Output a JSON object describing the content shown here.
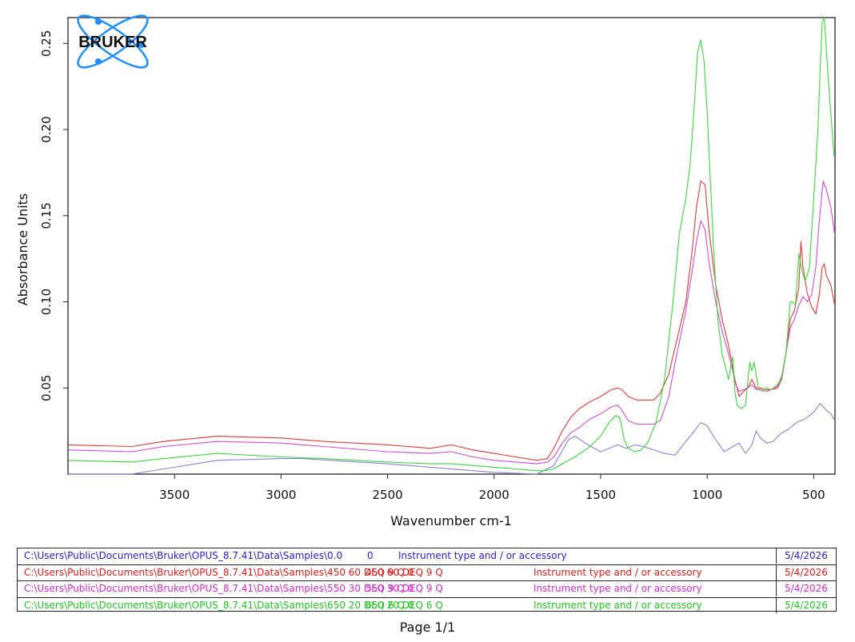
{
  "logo_text": "BRUKER",
  "chart_data": {
    "type": "line",
    "xlabel": "Wavenumber cm-1",
    "ylabel": "Absorbance Units",
    "xlim": [
      4000,
      400
    ],
    "ylim": [
      0,
      0.265
    ],
    "x_reversed": true,
    "grid": false,
    "x_ticks": [
      3500,
      3000,
      2500,
      2000,
      1500,
      1000,
      500
    ],
    "y_ticks": [
      0.05,
      0.1,
      0.15,
      0.2,
      0.25
    ],
    "y_tick_labels": [
      "0.05",
      "0.10",
      "0.15",
      "0.20",
      "0.25"
    ],
    "series": [
      {
        "name": "0",
        "color": "#8a80d8",
        "points": [
          [
            3998,
            0.0
          ],
          [
            3700,
            0.0
          ],
          [
            3550,
            0.003
          ],
          [
            3300,
            0.008
          ],
          [
            3000,
            0.009
          ],
          [
            2900,
            0.009
          ],
          [
            2500,
            0.006
          ],
          [
            2300,
            0.004
          ],
          [
            2000,
            0.001
          ],
          [
            1800,
            0.0
          ],
          [
            1720,
            0.005
          ],
          [
            1650,
            0.02
          ],
          [
            1620,
            0.022
          ],
          [
            1560,
            0.017
          ],
          [
            1500,
            0.013
          ],
          [
            1460,
            0.015
          ],
          [
            1420,
            0.017
          ],
          [
            1380,
            0.015
          ],
          [
            1340,
            0.017
          ],
          [
            1300,
            0.016
          ],
          [
            1200,
            0.012
          ],
          [
            1150,
            0.011
          ],
          [
            1100,
            0.019
          ],
          [
            1060,
            0.025
          ],
          [
            1030,
            0.03
          ],
          [
            1000,
            0.028
          ],
          [
            960,
            0.02
          ],
          [
            920,
            0.013
          ],
          [
            880,
            0.016
          ],
          [
            850,
            0.018
          ],
          [
            820,
            0.012
          ],
          [
            790,
            0.017
          ],
          [
            770,
            0.025
          ],
          [
            750,
            0.021
          ],
          [
            720,
            0.018
          ],
          [
            690,
            0.019
          ],
          [
            660,
            0.023
          ],
          [
            620,
            0.026
          ],
          [
            580,
            0.03
          ],
          [
            540,
            0.032
          ],
          [
            500,
            0.036
          ],
          [
            470,
            0.041
          ],
          [
            440,
            0.037
          ],
          [
            420,
            0.035
          ],
          [
            400,
            0.031
          ]
        ]
      },
      {
        "name": "450 60 DEQ 9 Q",
        "color": "#e23a3a",
        "points": [
          [
            3998,
            0.017
          ],
          [
            3700,
            0.016
          ],
          [
            3550,
            0.019
          ],
          [
            3300,
            0.022
          ],
          [
            3000,
            0.021
          ],
          [
            2800,
            0.019
          ],
          [
            2500,
            0.017
          ],
          [
            2300,
            0.015
          ],
          [
            2200,
            0.017
          ],
          [
            2100,
            0.014
          ],
          [
            2000,
            0.012
          ],
          [
            1900,
            0.01
          ],
          [
            1800,
            0.008
          ],
          [
            1750,
            0.009
          ],
          [
            1720,
            0.015
          ],
          [
            1680,
            0.025
          ],
          [
            1640,
            0.033
          ],
          [
            1600,
            0.038
          ],
          [
            1550,
            0.042
          ],
          [
            1500,
            0.045
          ],
          [
            1450,
            0.049
          ],
          [
            1420,
            0.05
          ],
          [
            1400,
            0.049
          ],
          [
            1370,
            0.045
          ],
          [
            1330,
            0.043
          ],
          [
            1300,
            0.043
          ],
          [
            1250,
            0.043
          ],
          [
            1220,
            0.047
          ],
          [
            1180,
            0.058
          ],
          [
            1150,
            0.074
          ],
          [
            1100,
            0.1
          ],
          [
            1070,
            0.13
          ],
          [
            1050,
            0.155
          ],
          [
            1030,
            0.17
          ],
          [
            1010,
            0.168
          ],
          [
            990,
            0.14
          ],
          [
            960,
            0.11
          ],
          [
            930,
            0.09
          ],
          [
            900,
            0.075
          ],
          [
            880,
            0.062
          ],
          [
            870,
            0.055
          ],
          [
            850,
            0.045
          ],
          [
            830,
            0.048
          ],
          [
            810,
            0.05
          ],
          [
            790,
            0.055
          ],
          [
            770,
            0.05
          ],
          [
            750,
            0.05
          ],
          [
            720,
            0.049
          ],
          [
            700,
            0.049
          ],
          [
            670,
            0.05
          ],
          [
            650,
            0.055
          ],
          [
            630,
            0.07
          ],
          [
            610,
            0.09
          ],
          [
            590,
            0.095
          ],
          [
            570,
            0.108
          ],
          [
            560,
            0.135
          ],
          [
            550,
            0.12
          ],
          [
            530,
            0.105
          ],
          [
            510,
            0.097
          ],
          [
            490,
            0.093
          ],
          [
            475,
            0.103
          ],
          [
            460,
            0.12
          ],
          [
            450,
            0.122
          ],
          [
            440,
            0.115
          ],
          [
            420,
            0.11
          ],
          [
            400,
            0.097
          ]
        ]
      },
      {
        "name": "550 30 DEQ 9 Q",
        "color": "#d64bd6",
        "points": [
          [
            3998,
            0.014
          ],
          [
            3700,
            0.013
          ],
          [
            3550,
            0.016
          ],
          [
            3300,
            0.019
          ],
          [
            3000,
            0.018
          ],
          [
            2800,
            0.016
          ],
          [
            2500,
            0.013
          ],
          [
            2300,
            0.012
          ],
          [
            2200,
            0.013
          ],
          [
            2100,
            0.01
          ],
          [
            2000,
            0.008
          ],
          [
            1900,
            0.007
          ],
          [
            1800,
            0.006
          ],
          [
            1750,
            0.007
          ],
          [
            1720,
            0.01
          ],
          [
            1680,
            0.018
          ],
          [
            1640,
            0.024
          ],
          [
            1600,
            0.027
          ],
          [
            1550,
            0.032
          ],
          [
            1500,
            0.035
          ],
          [
            1450,
            0.039
          ],
          [
            1420,
            0.04
          ],
          [
            1400,
            0.037
          ],
          [
            1370,
            0.031
          ],
          [
            1330,
            0.029
          ],
          [
            1300,
            0.029
          ],
          [
            1250,
            0.029
          ],
          [
            1220,
            0.031
          ],
          [
            1180,
            0.045
          ],
          [
            1150,
            0.065
          ],
          [
            1100,
            0.095
          ],
          [
            1070,
            0.118
          ],
          [
            1050,
            0.135
          ],
          [
            1030,
            0.147
          ],
          [
            1010,
            0.142
          ],
          [
            990,
            0.122
          ],
          [
            960,
            0.1
          ],
          [
            930,
            0.083
          ],
          [
            900,
            0.07
          ],
          [
            880,
            0.06
          ],
          [
            870,
            0.053
          ],
          [
            850,
            0.048
          ],
          [
            830,
            0.049
          ],
          [
            810,
            0.05
          ],
          [
            790,
            0.052
          ],
          [
            770,
            0.049
          ],
          [
            750,
            0.049
          ],
          [
            720,
            0.048
          ],
          [
            700,
            0.049
          ],
          [
            670,
            0.051
          ],
          [
            650,
            0.057
          ],
          [
            630,
            0.07
          ],
          [
            610,
            0.085
          ],
          [
            590,
            0.09
          ],
          [
            570,
            0.098
          ],
          [
            550,
            0.103
          ],
          [
            530,
            0.1
          ],
          [
            510,
            0.104
          ],
          [
            490,
            0.12
          ],
          [
            475,
            0.145
          ],
          [
            460,
            0.165
          ],
          [
            455,
            0.17
          ],
          [
            440,
            0.165
          ],
          [
            420,
            0.155
          ],
          [
            400,
            0.138
          ]
        ]
      },
      {
        "name": "650 20 DEQ 6 Q",
        "color": "#3bd63b",
        "points": [
          [
            3998,
            0.008
          ],
          [
            3700,
            0.007
          ],
          [
            3550,
            0.009
          ],
          [
            3300,
            0.012
          ],
          [
            3000,
            0.01
          ],
          [
            2800,
            0.009
          ],
          [
            2500,
            0.007
          ],
          [
            2300,
            0.006
          ],
          [
            2200,
            0.006
          ],
          [
            2100,
            0.005
          ],
          [
            2000,
            0.004
          ],
          [
            1900,
            0.003
          ],
          [
            1800,
            0.002
          ],
          [
            1760,
            0.002
          ],
          [
            1720,
            0.003
          ],
          [
            1680,
            0.006
          ],
          [
            1620,
            0.01
          ],
          [
            1560,
            0.015
          ],
          [
            1500,
            0.022
          ],
          [
            1460,
            0.03
          ],
          [
            1430,
            0.034
          ],
          [
            1410,
            0.033
          ],
          [
            1390,
            0.02
          ],
          [
            1370,
            0.015
          ],
          [
            1340,
            0.013
          ],
          [
            1310,
            0.014
          ],
          [
            1280,
            0.018
          ],
          [
            1240,
            0.03
          ],
          [
            1200,
            0.055
          ],
          [
            1160,
            0.1
          ],
          [
            1130,
            0.14
          ],
          [
            1100,
            0.16
          ],
          [
            1080,
            0.18
          ],
          [
            1060,
            0.215
          ],
          [
            1045,
            0.245
          ],
          [
            1030,
            0.252
          ],
          [
            1015,
            0.24
          ],
          [
            1000,
            0.21
          ],
          [
            985,
            0.17
          ],
          [
            970,
            0.13
          ],
          [
            950,
            0.09
          ],
          [
            930,
            0.07
          ],
          [
            900,
            0.055
          ],
          [
            880,
            0.068
          ],
          [
            870,
            0.048
          ],
          [
            860,
            0.04
          ],
          [
            840,
            0.038
          ],
          [
            820,
            0.04
          ],
          [
            800,
            0.065
          ],
          [
            790,
            0.06
          ],
          [
            780,
            0.065
          ],
          [
            760,
            0.05
          ],
          [
            740,
            0.048
          ],
          [
            720,
            0.05
          ],
          [
            700,
            0.049
          ],
          [
            670,
            0.052
          ],
          [
            650,
            0.056
          ],
          [
            630,
            0.07
          ],
          [
            610,
            0.1
          ],
          [
            600,
            0.1
          ],
          [
            585,
            0.098
          ],
          [
            570,
            0.128
          ],
          [
            555,
            0.118
          ],
          [
            540,
            0.112
          ],
          [
            520,
            0.12
          ],
          [
            500,
            0.16
          ],
          [
            480,
            0.2
          ],
          [
            470,
            0.235
          ],
          [
            460,
            0.262
          ],
          [
            450,
            0.265
          ],
          [
            440,
            0.245
          ],
          [
            420,
            0.21
          ],
          [
            405,
            0.185
          ],
          [
            400,
            0.185
          ]
        ]
      }
    ]
  },
  "legend_rows": [
    {
      "path": "C:\\Users\\Public\\Documents\\Bruker\\OPUS_8.7.41\\Data\\Samples\\0.0",
      "name": "0",
      "instrument": "Instrument type and / or accessory",
      "date": "5/4/2026",
      "color": "#2a22cc"
    },
    {
      "path": "C:\\Users\\Public\\Documents\\Bruker\\OPUS_8.7.41\\Data\\Samples\\450 60 DEQ 9 Q.0",
      "name": "450 60 DEQ 9 Q",
      "instrument": "Instrument type and / or accessory",
      "date": "5/4/2026",
      "color": "#e21a1a"
    },
    {
      "path": "C:\\Users\\Public\\Documents\\Bruker\\OPUS_8.7.41\\Data\\Samples\\550 30 DEQ 9 Q.0",
      "name": "550 30 DEQ 9 Q",
      "instrument": "Instrument type and / or accessory",
      "date": "5/4/2026",
      "color": "#d22ad2"
    },
    {
      "path": "C:\\Users\\Public\\Documents\\Bruker\\OPUS_8.7.41\\Data\\Samples\\650 20 DEQ 6 Q.0",
      "name": "650 20 DEQ 6 Q",
      "instrument": "Instrument type and / or accessory",
      "date": "5/4/2026",
      "color": "#22c422"
    }
  ],
  "footer": {
    "page_label": "Page 1/1"
  }
}
